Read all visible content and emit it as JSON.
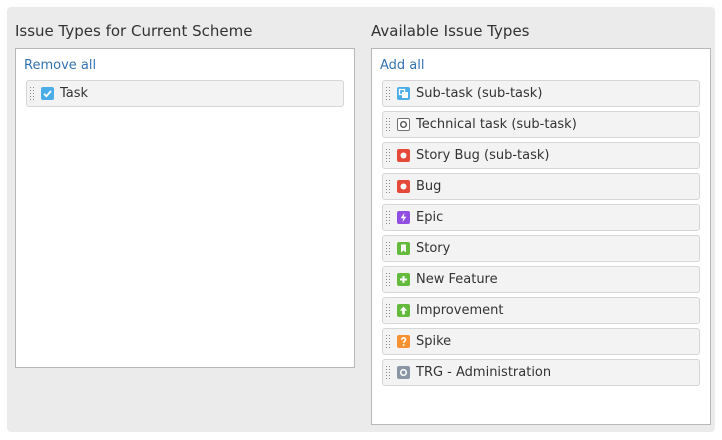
{
  "colors": {
    "link": "#3572b0",
    "task": "#4bade8",
    "subtask": "#4bade8",
    "technical_task": "#707070",
    "bug": "#e5493a",
    "epic": "#904ee2",
    "story": "#63ba3c",
    "new_feature": "#63ba3c",
    "improvement": "#63ba3c",
    "spike": "#f79232",
    "trg": "#8a96a3"
  },
  "current": {
    "title": "Issue Types for Current Scheme",
    "action": "Remove all",
    "items": [
      {
        "label": "Task",
        "icon": "task-checkbox-icon"
      }
    ]
  },
  "available": {
    "title": "Available Issue Types",
    "action": "Add all",
    "items": [
      {
        "label": "Sub-task (sub-task)",
        "icon": "subtask-icon"
      },
      {
        "label": "Technical task (sub-task)",
        "icon": "technical-task-icon"
      },
      {
        "label": "Story Bug (sub-task)",
        "icon": "bug-icon"
      },
      {
        "label": "Bug",
        "icon": "bug-icon"
      },
      {
        "label": "Epic",
        "icon": "epic-lightning-icon"
      },
      {
        "label": "Story",
        "icon": "story-bookmark-icon"
      },
      {
        "label": "New Feature",
        "icon": "plus-icon"
      },
      {
        "label": "Improvement",
        "icon": "up-arrow-icon"
      },
      {
        "label": "Spike",
        "icon": "question-icon"
      },
      {
        "label": "TRG - Administration",
        "icon": "admin-circle-icon"
      }
    ]
  }
}
